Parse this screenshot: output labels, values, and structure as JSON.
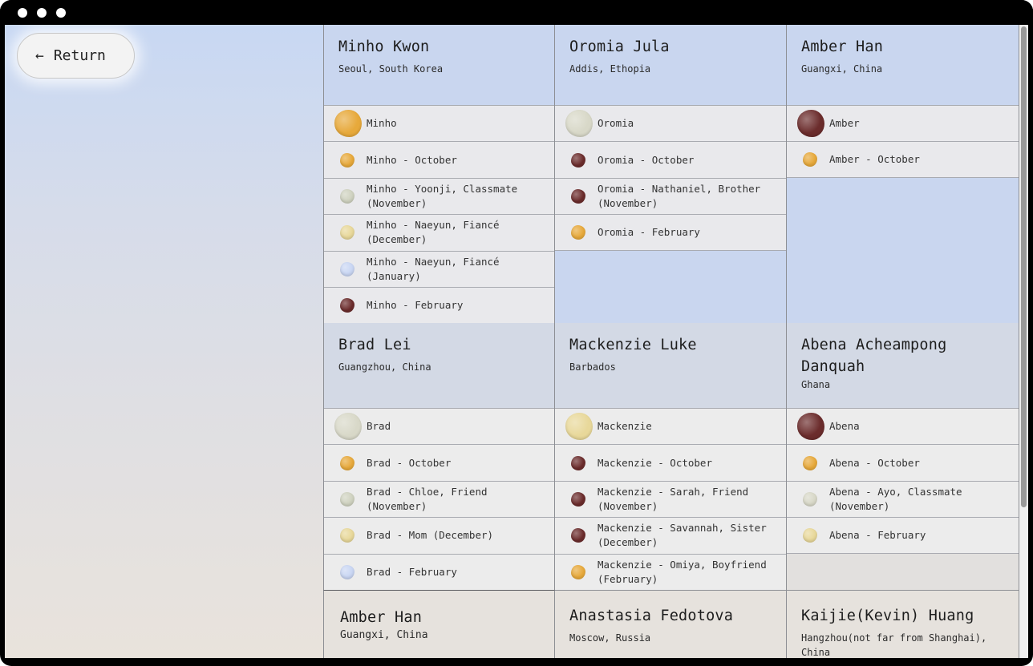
{
  "app": {
    "return_label": "Return"
  },
  "colors": {
    "gold": "#e7a93b",
    "maroon": "#6b2c2c",
    "pale_sage": "#cfd2c0",
    "pale_yellow": "#e8d89a",
    "pale_blue": "#c9d6f3",
    "blue_sand": "#d8d8c8"
  },
  "row1": [
    {
      "name": "Minho Kwon",
      "location": "Seoul, South Korea",
      "items": [
        {
          "label": "Minho",
          "stone": "gold",
          "size": "big"
        },
        {
          "label": "Minho - October",
          "stone": "gold"
        },
        {
          "label": "Minho - Yoonji, Classmate (November)",
          "stone": "pale_sage"
        },
        {
          "label": "Minho - Naeyun, Fiancé (December)",
          "stone": "pale_yellow"
        },
        {
          "label": "Minho - Naeyun, Fiancé (January)",
          "stone": "pale_blue"
        },
        {
          "label": "Minho - February",
          "stone": "maroon"
        }
      ]
    },
    {
      "name": "Oromia Jula",
      "location": "Addis, Ethopia",
      "items": [
        {
          "label": "Oromia",
          "stone": "blue_sand",
          "size": "big"
        },
        {
          "label": "Oromia - October",
          "stone": "maroon"
        },
        {
          "label": "Oromia - Nathaniel, Brother (November)",
          "stone": "maroon"
        },
        {
          "label": "Oromia - February",
          "stone": "gold"
        }
      ]
    },
    {
      "name": "Amber Han",
      "location": "Guangxi, China",
      "items": [
        {
          "label": "Amber",
          "stone": "maroon",
          "size": "big"
        },
        {
          "label": "Amber - October",
          "stone": "gold"
        }
      ]
    }
  ],
  "row2": [
    {
      "name": "Brad Lei",
      "location": "Guangzhou, China",
      "items": [
        {
          "label": "Brad",
          "stone": "blue_sand",
          "size": "big"
        },
        {
          "label": "Brad - October",
          "stone": "gold"
        },
        {
          "label": "Brad - Chloe, Friend (November)",
          "stone": "pale_sage"
        },
        {
          "label": "Brad - Mom (December)",
          "stone": "pale_yellow"
        },
        {
          "label": "Brad - February",
          "stone": "pale_blue"
        }
      ]
    },
    {
      "name": "Mackenzie Luke",
      "location": "Barbados",
      "items": [
        {
          "label": "Mackenzie",
          "stone": "pale_yellow",
          "size": "big"
        },
        {
          "label": "Mackenzie - October",
          "stone": "maroon"
        },
        {
          "label": "Mackenzie - Sarah, Friend (November)",
          "stone": "maroon"
        },
        {
          "label": "Mackenzie - Savannah, Sister (December)",
          "stone": "maroon"
        },
        {
          "label": "Mackenzie - Omiya, Boyfriend (February)",
          "stone": "gold"
        }
      ]
    },
    {
      "name": "Abena Acheampong Danquah",
      "location": "Ghana",
      "items": [
        {
          "label": "Abena",
          "stone": "maroon",
          "size": "big"
        },
        {
          "label": "Abena - October",
          "stone": "gold"
        },
        {
          "label": "Abena - Ayo, Classmate (November)",
          "stone": "blue_sand"
        },
        {
          "label": "Abena - February",
          "stone": "pale_yellow"
        }
      ]
    }
  ],
  "row3": [
    {
      "name": "Amber Han",
      "location": "Guangxi, China"
    },
    {
      "name": "Anastasia Fedotova",
      "location": "Moscow, Russia"
    },
    {
      "name": "Kaijie(Kevin) Huang",
      "location": "Hangzhou(not far from Shanghai), China"
    }
  ]
}
